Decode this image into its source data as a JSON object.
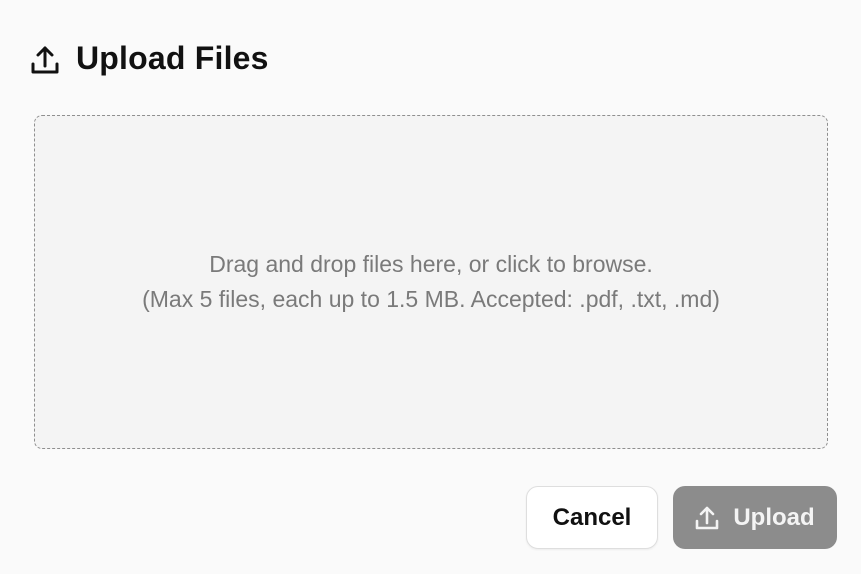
{
  "header": {
    "icon": "upload-icon",
    "title": "Upload Files"
  },
  "dropzone": {
    "hint_line_1": "Drag and drop files here, or click to browse.",
    "hint_line_2": "(Max 5 files, each up to 1.5 MB. Accepted: .pdf, .txt, .md)"
  },
  "actions": {
    "cancel_label": "Cancel",
    "upload_label": "Upload",
    "upload_icon": "upload-icon",
    "upload_disabled": true
  },
  "colors": {
    "background": "#fafafa",
    "dropzone_background": "#f4f4f4",
    "upload_button_disabled": "#8c8c8c",
    "text_primary": "#111111",
    "text_muted": "#7a7a7a"
  }
}
